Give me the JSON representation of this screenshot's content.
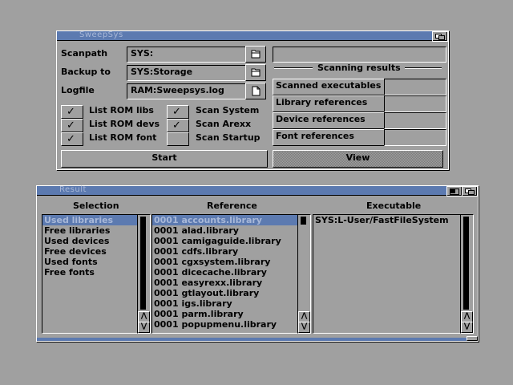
{
  "sweepsys": {
    "title": "SweepSys",
    "scanpath_label": "Scanpath",
    "scanpath_value": "SYS:",
    "backup_label": "Backup to",
    "backup_value": "SYS:Storage",
    "logfile_label": "Logfile",
    "logfile_value": "RAM:Sweepsys.log",
    "options": [
      {
        "label": "List ROM libs",
        "checked": true
      },
      {
        "label": "List ROM devs",
        "checked": true
      },
      {
        "label": "List ROM font",
        "checked": true
      },
      {
        "label": "Scan System",
        "checked": true
      },
      {
        "label": "Scan Arexx",
        "checked": true
      },
      {
        "label": "Scan Startup",
        "checked": false
      }
    ],
    "start_label": "Start",
    "status_value": "",
    "results_heading": "Scanning results",
    "results": [
      {
        "label": "Scanned executables",
        "value": ""
      },
      {
        "label": "Library references",
        "value": ""
      },
      {
        "label": "Device references",
        "value": ""
      },
      {
        "label": "Font references",
        "value": ""
      }
    ],
    "view_label": "View"
  },
  "result": {
    "title": "Result",
    "col_selection": "Selection",
    "col_reference": "Reference",
    "col_executable": "Executable",
    "selection_items": [
      "Used libraries",
      "Free libraries",
      "Used devices",
      "Free devices",
      "Used fonts",
      "Free fonts"
    ],
    "reference_items": [
      "0001 accounts.library",
      "0001 alad.library",
      "0001 camigaguide.library",
      "0001 cdfs.library",
      "0001 cgxsystem.library",
      "0001 dicecache.library",
      "0001 easyrexx.library",
      "0001 gtlayout.library",
      "0001 igs.library",
      "0001 parm.library",
      "0001 popupmenu.library"
    ],
    "executable_items": [
      "SYS:L-User/FastFileSystem"
    ]
  },
  "colors": {
    "background": "#a0a0a0",
    "titlebar": "#5c7ab0",
    "selection": "#5c7ab0"
  },
  "icons": {
    "checkbox": "checkmark-icon",
    "file": "file-requester-icon",
    "scroll_up": "arrow-up-icon",
    "scroll_down": "arrow-down-icon"
  }
}
